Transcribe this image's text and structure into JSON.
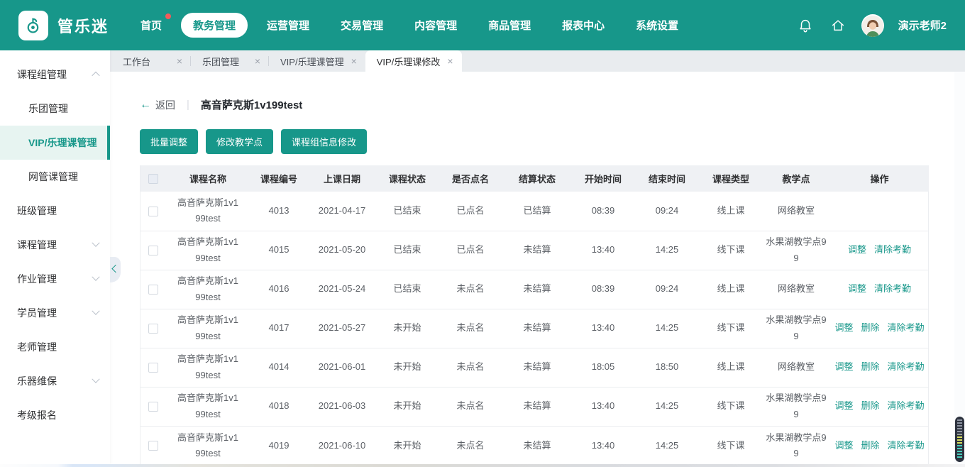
{
  "colors": {
    "accent": "#17978a",
    "accent_light_bg": "#e7f4f1",
    "badge_red": "#f25b5b",
    "tabbar_bg": "#e9ecef",
    "table_header_bg": "#eff1f4"
  },
  "navbar": {
    "brand": "管乐迷",
    "logo_icon": "music-note-icon",
    "items": [
      {
        "label": "首页",
        "active": false,
        "badge": true
      },
      {
        "label": "教务管理",
        "active": true,
        "badge": false
      },
      {
        "label": "运营管理",
        "active": false,
        "badge": false
      },
      {
        "label": "交易管理",
        "active": false,
        "badge": false
      },
      {
        "label": "内容管理",
        "active": false,
        "badge": false
      },
      {
        "label": "商品管理",
        "active": false,
        "badge": false
      },
      {
        "label": "报表中心",
        "active": false,
        "badge": false
      },
      {
        "label": "系统设置",
        "active": false,
        "badge": false
      }
    ],
    "right_icons": [
      "bell-icon",
      "home-icon"
    ],
    "user": {
      "name": "演示老师2",
      "avatar": "person-avatar"
    }
  },
  "sidebar": {
    "items": [
      {
        "label": "课程组管理",
        "level": 1,
        "chevron": "up",
        "selected": false
      },
      {
        "label": "乐团管理",
        "level": 2,
        "chevron": "",
        "selected": false
      },
      {
        "label": "VIP/乐理课管理",
        "level": 2,
        "chevron": "",
        "selected": true
      },
      {
        "label": "网管课管理",
        "level": 2,
        "chevron": "",
        "selected": false
      },
      {
        "label": "班级管理",
        "level": 1,
        "chevron": "",
        "selected": false
      },
      {
        "label": "课程管理",
        "level": 1,
        "chevron": "down",
        "selected": false
      },
      {
        "label": "作业管理",
        "level": 1,
        "chevron": "down",
        "selected": false
      },
      {
        "label": "学员管理",
        "level": 1,
        "chevron": "down",
        "selected": false
      },
      {
        "label": "老师管理",
        "level": 1,
        "chevron": "",
        "selected": false
      },
      {
        "label": "乐器维保",
        "level": 1,
        "chevron": "down",
        "selected": false
      },
      {
        "label": "考级报名",
        "level": 1,
        "chevron": "",
        "selected": false
      }
    ],
    "collapse_handle_icon": "chevron-left-icon"
  },
  "tabs": [
    {
      "label": "工作台",
      "active": false
    },
    {
      "label": "乐团管理",
      "active": false
    },
    {
      "label": "VIP/乐理课管理",
      "active": false
    },
    {
      "label": "VIP/乐理课修改",
      "active": true
    }
  ],
  "page": {
    "back_label": "返回",
    "title": "高音萨克斯1v199test"
  },
  "toolbar": {
    "buttons": [
      "批量调整",
      "修改教学点",
      "课程组信息修改"
    ]
  },
  "table": {
    "columns": [
      "课程名称",
      "课程编号",
      "上课日期",
      "课程状态",
      "是否点名",
      "结算状态",
      "开始时间",
      "结束时间",
      "课程类型",
      "教学点",
      "操作"
    ],
    "rows": [
      {
        "name": "高音萨克斯1v199test",
        "code": "4013",
        "date": "2021-04-17",
        "status": "已结束",
        "rollcall": "已点名",
        "settlement": "已结算",
        "start": "08:39",
        "end": "09:24",
        "type": "线上课",
        "venue": "网络教室",
        "actions": []
      },
      {
        "name": "高音萨克斯1v199test",
        "code": "4015",
        "date": "2021-05-20",
        "status": "已结束",
        "rollcall": "已点名",
        "settlement": "未结算",
        "start": "13:40",
        "end": "14:25",
        "type": "线下课",
        "venue": "水果湖教学点99",
        "actions": [
          "调整",
          "清除考勤"
        ]
      },
      {
        "name": "高音萨克斯1v199test",
        "code": "4016",
        "date": "2021-05-24",
        "status": "已结束",
        "rollcall": "未点名",
        "settlement": "未结算",
        "start": "08:39",
        "end": "09:24",
        "type": "线上课",
        "venue": "网络教室",
        "actions": [
          "调整",
          "清除考勤"
        ]
      },
      {
        "name": "高音萨克斯1v199test",
        "code": "4017",
        "date": "2021-05-27",
        "status": "未开始",
        "rollcall": "未点名",
        "settlement": "未结算",
        "start": "13:40",
        "end": "14:25",
        "type": "线下课",
        "venue": "水果湖教学点99",
        "actions": [
          "调整",
          "删除",
          "清除考勤"
        ]
      },
      {
        "name": "高音萨克斯1v199test",
        "code": "4014",
        "date": "2021-06-01",
        "status": "未开始",
        "rollcall": "未点名",
        "settlement": "未结算",
        "start": "18:05",
        "end": "18:50",
        "type": "线上课",
        "venue": "网络教室",
        "actions": [
          "调整",
          "删除",
          "清除考勤"
        ]
      },
      {
        "name": "高音萨克斯1v199test",
        "code": "4018",
        "date": "2021-06-03",
        "status": "未开始",
        "rollcall": "未点名",
        "settlement": "未结算",
        "start": "13:40",
        "end": "14:25",
        "type": "线下课",
        "venue": "水果湖教学点99",
        "actions": [
          "调整",
          "删除",
          "清除考勤"
        ]
      },
      {
        "name": "高音萨克斯1v199test",
        "code": "4019",
        "date": "2021-06-10",
        "status": "未开始",
        "rollcall": "未点名",
        "settlement": "未结算",
        "start": "13:40",
        "end": "14:25",
        "type": "线下课",
        "venue": "水果湖教学点99",
        "actions": [
          "调整",
          "删除",
          "清除考勤"
        ]
      }
    ],
    "action_names": {
      "调整": "adjust-link",
      "删除": "delete-link",
      "清除考勤": "clear-attendance-link"
    }
  }
}
